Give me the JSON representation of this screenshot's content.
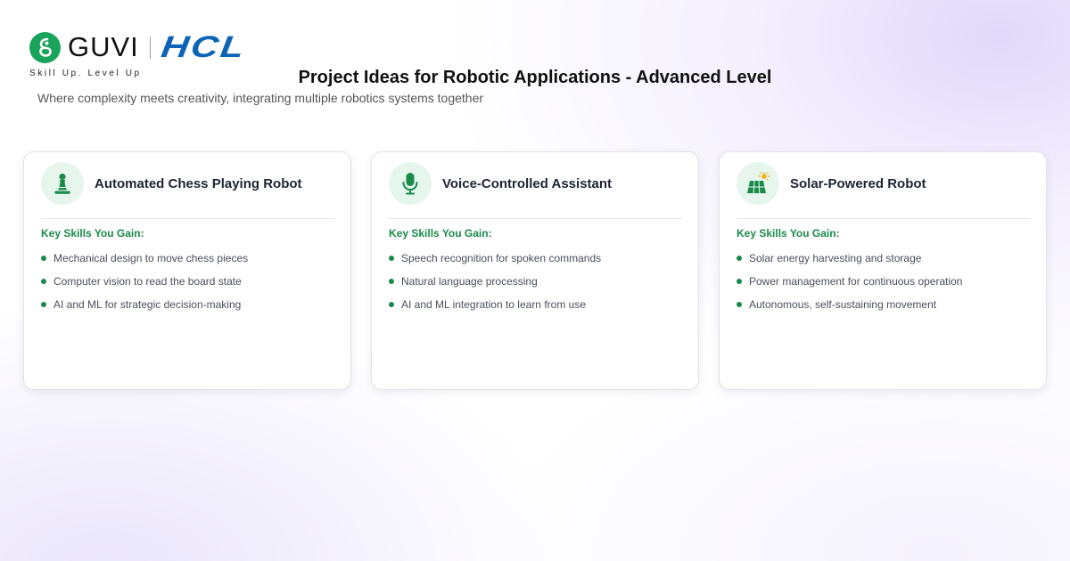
{
  "brand": {
    "guvi_name": "GUVI",
    "partner_name": "HCL",
    "tagline": "Skill Up. Level Up",
    "guvi_color": "#1aa35a",
    "hcl_color": "#0b64b5"
  },
  "header": {
    "title": "Project Ideas for Robotic Applications - Advanced Level",
    "subtitle": "Where complexity meets creativity, integrating multiple robotics systems together"
  },
  "cards": [
    {
      "icon": "chess-pawn-icon",
      "title": "Automated Chess Playing Robot",
      "skills_heading": "Key Skills You Gain:",
      "skills": [
        "Mechanical design to move chess pieces",
        "Computer vision to read the board state",
        "AI and ML for strategic decision-making"
      ]
    },
    {
      "icon": "microphone-icon",
      "title": "Voice-Controlled Assistant",
      "skills_heading": "Key Skills You Gain:",
      "skills": [
        "Speech recognition for spoken commands",
        "Natural language processing",
        "AI and ML integration to learn from use"
      ]
    },
    {
      "icon": "solar-panel-icon",
      "title": "Solar-Powered Robot",
      "skills_heading": "Key Skills You Gain:",
      "skills": [
        "Solar energy harvesting and storage",
        "Power management for continuous operation",
        "Autonomous, self-sustaining movement"
      ]
    }
  ],
  "colors": {
    "accent_green": "#1a8a4a",
    "icon_bg": "#e6f6ec"
  }
}
